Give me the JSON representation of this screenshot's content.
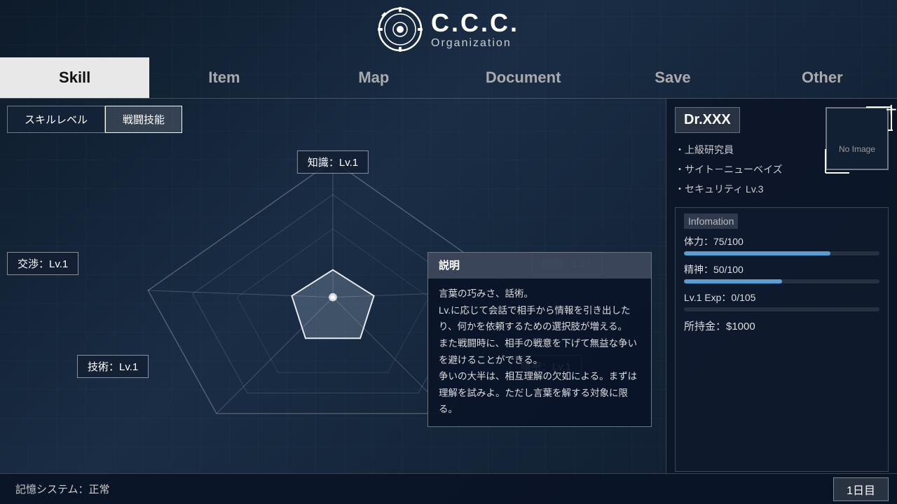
{
  "header": {
    "logo_title": "C.C.C.",
    "logo_subtitle": "Organization"
  },
  "nav": {
    "tabs": [
      {
        "id": "skill",
        "label": "Skill",
        "active": true
      },
      {
        "id": "item",
        "label": "Item",
        "active": false
      },
      {
        "id": "map",
        "label": "Map",
        "active": false
      },
      {
        "id": "document",
        "label": "Document",
        "active": false
      },
      {
        "id": "save",
        "label": "Save",
        "active": false
      },
      {
        "id": "other",
        "label": "Other",
        "active": false
      }
    ]
  },
  "skill_panel": {
    "sub_tabs": [
      {
        "id": "skill-level",
        "label": "スキルレベル",
        "active": false
      },
      {
        "id": "combat-skill",
        "label": "戦闘技能",
        "active": true
      }
    ],
    "skill_labels": [
      {
        "id": "knowledge",
        "label": "知識：Lv.1",
        "position": "top"
      },
      {
        "id": "combat",
        "label": "戦闘：Lv.1",
        "position": "right",
        "active": true
      },
      {
        "id": "negotiation",
        "label": "交渉：Lv.1",
        "position": "left"
      },
      {
        "id": "technology",
        "label": "技術：Lv.1",
        "position": "bottom-left"
      },
      {
        "id": "stealth",
        "label": "隠密：Lv.1",
        "position": "bottom-right"
      }
    ],
    "description": {
      "title": "説明",
      "text": "言葉の巧みさ、話術。\nLv.に応じて会話で相手から情報を引き出したり、何かを依頼するための選択肢が増える。\nまた戦闘時に、相手の戦意を下げて無益な争いを避けることができる。\n争いの大半は、相互理解の欠如による。まずは理解を試みよ。ただし言葉を解する対象に限る。"
    }
  },
  "right_panel": {
    "character": {
      "name": "Dr.XXX",
      "details": [
        "・上級研究員",
        "・サイト－ニューベイズ",
        "・セキュリティ Lv.3"
      ],
      "image_placeholder": "No Image"
    },
    "info_title": "Infomation",
    "stats": [
      {
        "label": "体力：75/100",
        "bar_class": "hp",
        "width": "75%"
      },
      {
        "label": "精神：50/100",
        "bar_class": "mp",
        "width": "50%"
      },
      {
        "label": "Lv.1  Exp：0/105",
        "bar_class": "exp",
        "width": "0%"
      }
    ],
    "money": "所持金：$1000"
  },
  "footer": {
    "memory_status": "記憶システム：正常",
    "day": "1日目"
  }
}
